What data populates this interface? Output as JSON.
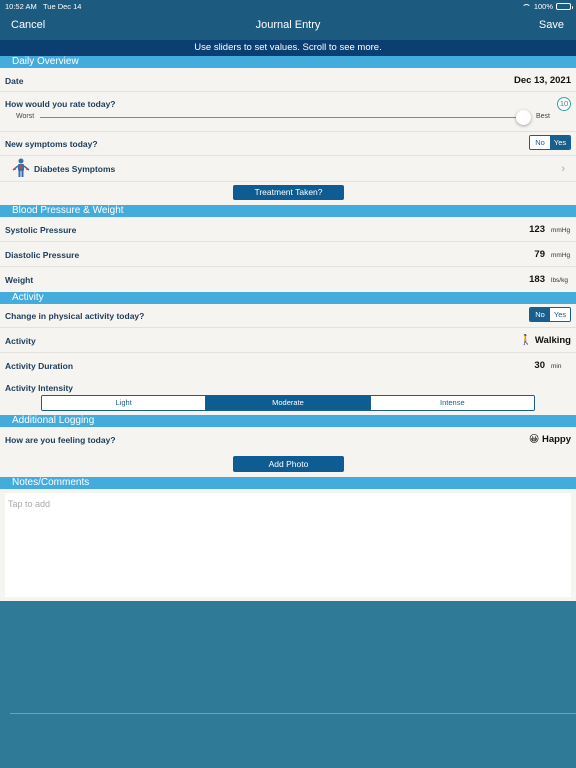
{
  "status": {
    "time": "10:52 AM",
    "date": "Tue Dec 14",
    "battery": "100%"
  },
  "nav": {
    "left": "Cancel",
    "title": "Journal Entry",
    "right": "Save"
  },
  "hint": "Use sliders to set values. Scroll to see more.",
  "daily": {
    "header": "Daily Overview",
    "date_label": "Date",
    "date_value": "Dec 13, 2021",
    "rate_label": "How would you rate today?",
    "rate_value": "10",
    "rate_fraction": 1.0,
    "slider_min": "Worst",
    "slider_max": "Best",
    "symptoms_label": "New symptoms today?",
    "symptoms_no": "No",
    "symptoms_yes": "Yes",
    "symptoms_selected": "Yes",
    "diabetes_label": "Diabetes Symptoms",
    "treatment_button": "Treatment Taken?"
  },
  "bp": {
    "header": "Blood Pressure & Weight",
    "systolic_label": "Systolic Pressure",
    "systolic_value": "123",
    "systolic_unit": "mmHg",
    "diastolic_label": "Diastolic Pressure",
    "diastolic_value": "79",
    "diastolic_unit": "mmHg",
    "weight_label": "Weight",
    "weight_value": "183",
    "weight_unit": "lbs/kg"
  },
  "activity": {
    "header": "Activity",
    "change_label": "Change in physical activity today?",
    "change_no": "No",
    "change_yes": "Yes",
    "change_selected": "No",
    "activity_label": "Activity",
    "activity_value": "Walking",
    "activity_icon": "walking-person-icon",
    "duration_label": "Activity Duration",
    "duration_value": "30",
    "duration_unit": "min",
    "intensity_label": "Activity Intensity",
    "intensity_options": [
      "Light",
      "Moderate",
      "Intense"
    ],
    "intensity_selected": "Moderate"
  },
  "logging": {
    "header": "Additional Logging",
    "feeling_label": "How are you feeling today?",
    "feeling_value": "Happy",
    "feeling_icon": "happy-face-icon",
    "photo_button": "Add Photo"
  },
  "notes": {
    "header": "Notes/Comments",
    "placeholder": "Tap to add"
  },
  "colors": {
    "nav_bg": "#1c5a80",
    "hint_bg": "#0c3f71",
    "section_bg": "#43acdd",
    "button_bg": "#0f5c92",
    "content_bg": "#f6f4f0",
    "page_bg": "#2f7a96"
  }
}
